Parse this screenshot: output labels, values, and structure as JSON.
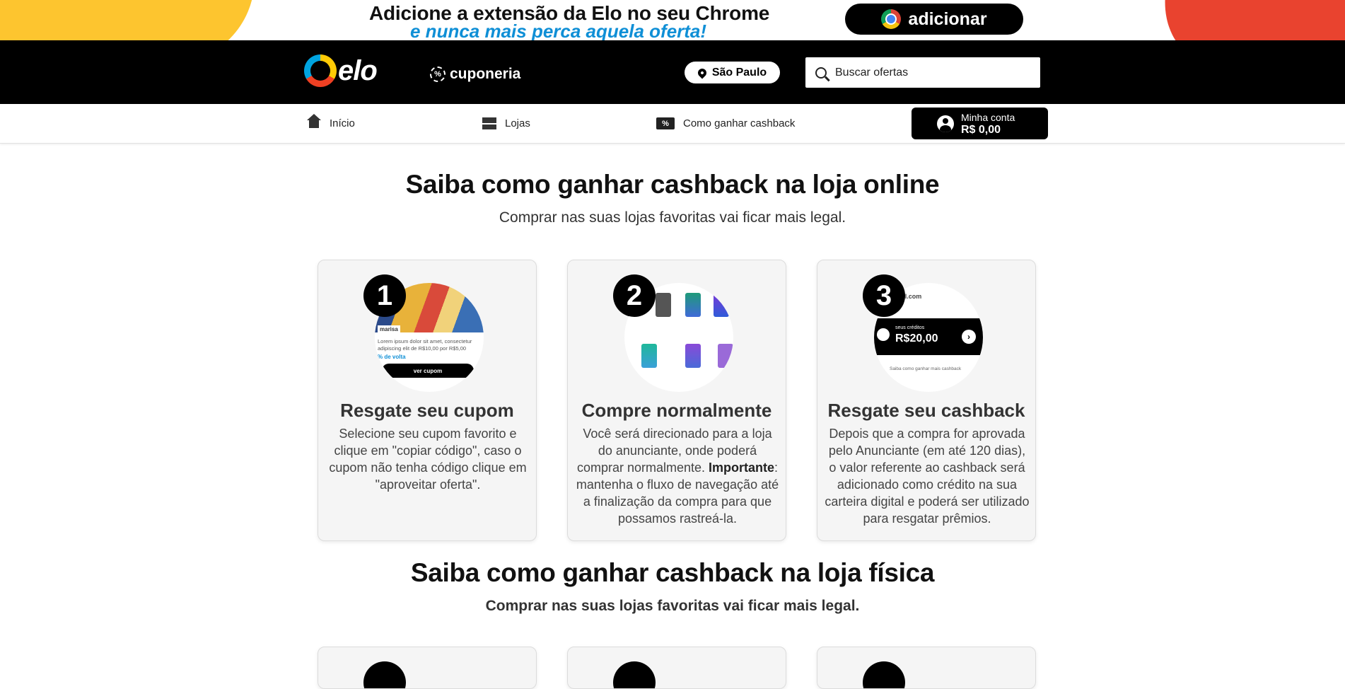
{
  "promo": {
    "line1": "Adicione a extensão da Elo no seu Chrome",
    "line2": "e nunca mais perca aquela oferta!",
    "button_label": "adicionar"
  },
  "header": {
    "logo_text": "elo",
    "cuponeria_label": "cuponeria",
    "city": "São Paulo",
    "search_placeholder": "Buscar ofertas"
  },
  "nav": {
    "items": [
      {
        "label": "Início",
        "icon": "home-icon"
      },
      {
        "label": "Lojas",
        "icon": "store-icon"
      },
      {
        "label": "Como ganhar cashback",
        "icon": "cashback-icon"
      }
    ],
    "account": {
      "label": "Minha conta",
      "balance": "R$ 0,00"
    }
  },
  "online": {
    "title": "Saiba como ganhar cashback na loja online",
    "subtitle": "Comprar nas suas lojas favoritas vai ficar mais legal.",
    "steps": [
      {
        "number": "1",
        "title": "Resgate seu cupom",
        "text": "Selecione seu cupom favorito e clique em \"copiar código\", caso o cupom não tenha código clique em \"aproveitar oferta\"."
      },
      {
        "number": "2",
        "title": "Compre normalmente",
        "text_before": "Você será direcionado para a loja do anunciante, onde poderá comprar normalmente. ",
        "text_bold": "Importante",
        "text_after": ": mantenha o fluxo de navegação até a finalização da compra para que possamos rastreá-la."
      },
      {
        "number": "3",
        "title": "Resgate seu cashback",
        "text": "Depois que a compra for aprovada pelo Anunciante (em até 120 dias), o valor referente ao cashback será adicionado como crédito na sua carteira digital e poderá ser utilizado para resgatar prêmios."
      }
    ],
    "art": {
      "brand": "marisa",
      "coupon_text": "Lorem ipsum dolor sit amet, consectetur adipiscing elit de R$10,00 por R$5,00",
      "cashback_tag": "% de volta",
      "coupon_button": "ver cupom",
      "email": "@gmail.com",
      "credits_label": "seus créditos",
      "credits_value": "R$20,00",
      "credits_link": "Saiba como ganhar mais cashback"
    }
  },
  "physical": {
    "title": "Saiba como ganhar cashback na loja física",
    "subtitle": "Comprar nas suas lojas favoritas vai ficar mais legal."
  }
}
